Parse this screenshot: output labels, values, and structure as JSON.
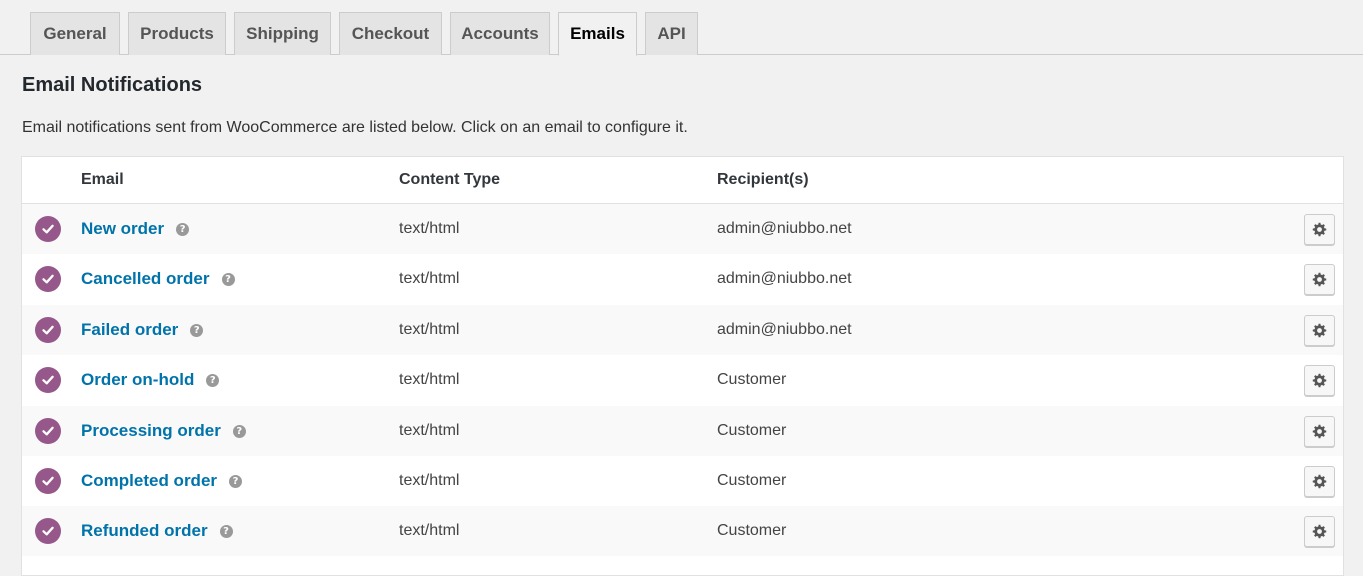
{
  "tabs": [
    {
      "label": "General"
    },
    {
      "label": "Products"
    },
    {
      "label": "Shipping"
    },
    {
      "label": "Checkout"
    },
    {
      "label": "Accounts"
    },
    {
      "label": "Emails",
      "active": true
    },
    {
      "label": "API"
    }
  ],
  "page": {
    "title": "Email Notifications",
    "description": "Email notifications sent from WooCommerce are listed below. Click on an email to configure it."
  },
  "table": {
    "columns": [
      "Email",
      "Content Type",
      "Recipient(s)"
    ],
    "rows": [
      {
        "name": "New order",
        "content_type": "text/html",
        "recipient": "admin@niubbo.net",
        "enabled": true
      },
      {
        "name": "Cancelled order",
        "content_type": "text/html",
        "recipient": "admin@niubbo.net",
        "enabled": true
      },
      {
        "name": "Failed order",
        "content_type": "text/html",
        "recipient": "admin@niubbo.net",
        "enabled": true
      },
      {
        "name": "Order on-hold",
        "content_type": "text/html",
        "recipient": "Customer",
        "enabled": true
      },
      {
        "name": "Processing order",
        "content_type": "text/html",
        "recipient": "Customer",
        "enabled": true
      },
      {
        "name": "Completed order",
        "content_type": "text/html",
        "recipient": "Customer",
        "enabled": true
      },
      {
        "name": "Refunded order",
        "content_type": "text/html",
        "recipient": "Customer",
        "enabled": true
      }
    ]
  },
  "icons": {
    "status": "check-circle-icon",
    "help": "help-icon",
    "manage": "gear-icon"
  },
  "colors": {
    "accent": "#96588a",
    "link": "#0073aa"
  }
}
